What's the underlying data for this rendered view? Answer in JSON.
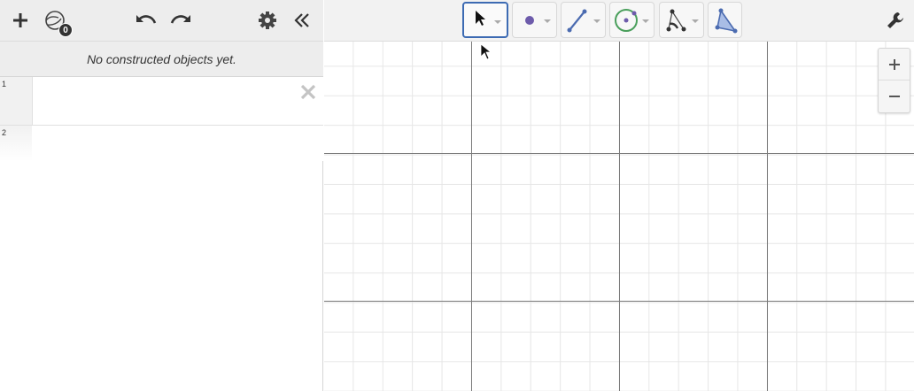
{
  "algebra": {
    "empty_message": "No constructed objects yet.",
    "badge_count": "0",
    "rows": [
      {
        "number": "1"
      },
      {
        "number": "2"
      }
    ]
  },
  "left_toolbar": {
    "icons": [
      "plus-icon",
      "view-menu-icon",
      "undo-icon",
      "redo-icon",
      "gear-icon",
      "collapse-icon"
    ]
  },
  "tools": [
    {
      "name": "move-tool",
      "active": true
    },
    {
      "name": "point-tool",
      "active": false
    },
    {
      "name": "line-tool",
      "active": false
    },
    {
      "name": "circle-tool",
      "active": false
    },
    {
      "name": "angle-tool",
      "active": false
    },
    {
      "name": "polygon-tool",
      "active": false
    }
  ],
  "colors": {
    "active_tool_border": "#3d6bb3",
    "point_purple": "#6d5bab",
    "line_blue": "#4b6bb0",
    "circle_green": "#4a9f5c",
    "polygon_blue": "#6b8ed0",
    "axis": "#7a7a7a",
    "grid": "#e6e6e6"
  }
}
